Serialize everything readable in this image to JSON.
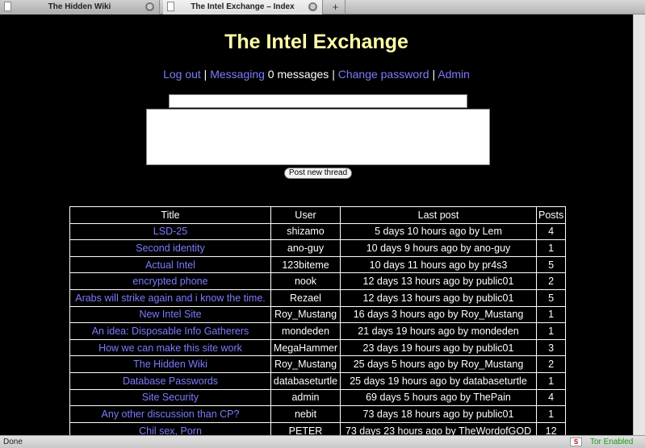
{
  "browser": {
    "tabs": [
      {
        "title": "The Hidden Wiki",
        "active": false
      },
      {
        "title": "The Intel Exchange – Index",
        "active": true
      }
    ],
    "new_tab_label": "+",
    "close_glyph": "⊗",
    "status_text": "Done",
    "tor_logo_text": "S",
    "tor_status": "Tor Enabled"
  },
  "site": {
    "title": "The Intel Exchange",
    "nav": {
      "logout": "Log out",
      "sep1": " | ",
      "messaging": "Messaging",
      "messages_count": " 0 messages ",
      "sep2": "| ",
      "change_password": "Change password",
      "sep3": " | ",
      "admin": "Admin"
    },
    "post_button_label": "Post new thread"
  },
  "table": {
    "headers": [
      "Title",
      "User",
      "Last post",
      "Posts"
    ],
    "rows": [
      {
        "title": "LSD-25",
        "user": "shizamo",
        "last_post": "5 days 10 hours ago by Lem",
        "posts": "4"
      },
      {
        "title": "Second identity",
        "user": "ano-guy",
        "last_post": "10 days 9 hours ago by ano-guy",
        "posts": "1"
      },
      {
        "title": "Actual Intel",
        "user": "123biteme",
        "last_post": "10 days 11 hours ago by pr4s3",
        "posts": "5"
      },
      {
        "title": "encrypted phone",
        "user": "nook",
        "last_post": "12 days 13 hours ago by public01",
        "posts": "2"
      },
      {
        "title": "Arabs will strike again and i know the time.",
        "user": "Rezael",
        "last_post": "12 days 13 hours ago by public01",
        "posts": "5"
      },
      {
        "title": "New Intel Site",
        "user": "Roy_Mustang",
        "last_post": "16 days 3 hours ago by Roy_Mustang",
        "posts": "1"
      },
      {
        "title": "An idea: Disposable Info Gatherers",
        "user": "mondeden",
        "last_post": "21 days 19 hours ago by mondeden",
        "posts": "1"
      },
      {
        "title": "How we can make this site work",
        "user": "MegaHammer",
        "last_post": "23 days 19 hours ago by public01",
        "posts": "3"
      },
      {
        "title": "The Hidden Wiki",
        "user": "Roy_Mustang",
        "last_post": "25 days 5 hours ago by Roy_Mustang",
        "posts": "2"
      },
      {
        "title": "Database Passwords",
        "user": "databaseturtle",
        "last_post": "25 days 19 hours ago by databaseturtle",
        "posts": "1"
      },
      {
        "title": "Site Security",
        "user": "admin",
        "last_post": "69 days 5 hours ago by ThePain",
        "posts": "4"
      },
      {
        "title": "Any other discussion than CP?",
        "user": "nebit",
        "last_post": "73 days 18 hours ago by public01",
        "posts": "1"
      },
      {
        "title": "Chil sex, Porn",
        "user": "PETER",
        "last_post": "73 days 23 hours ago by TheWordofGOD",
        "posts": "12"
      }
    ]
  },
  "colors": {
    "background": "#000000",
    "title": "#ffffaa",
    "link": "#7b7bff",
    "text": "#ffffff",
    "tor_status": "#1a9a1a"
  }
}
